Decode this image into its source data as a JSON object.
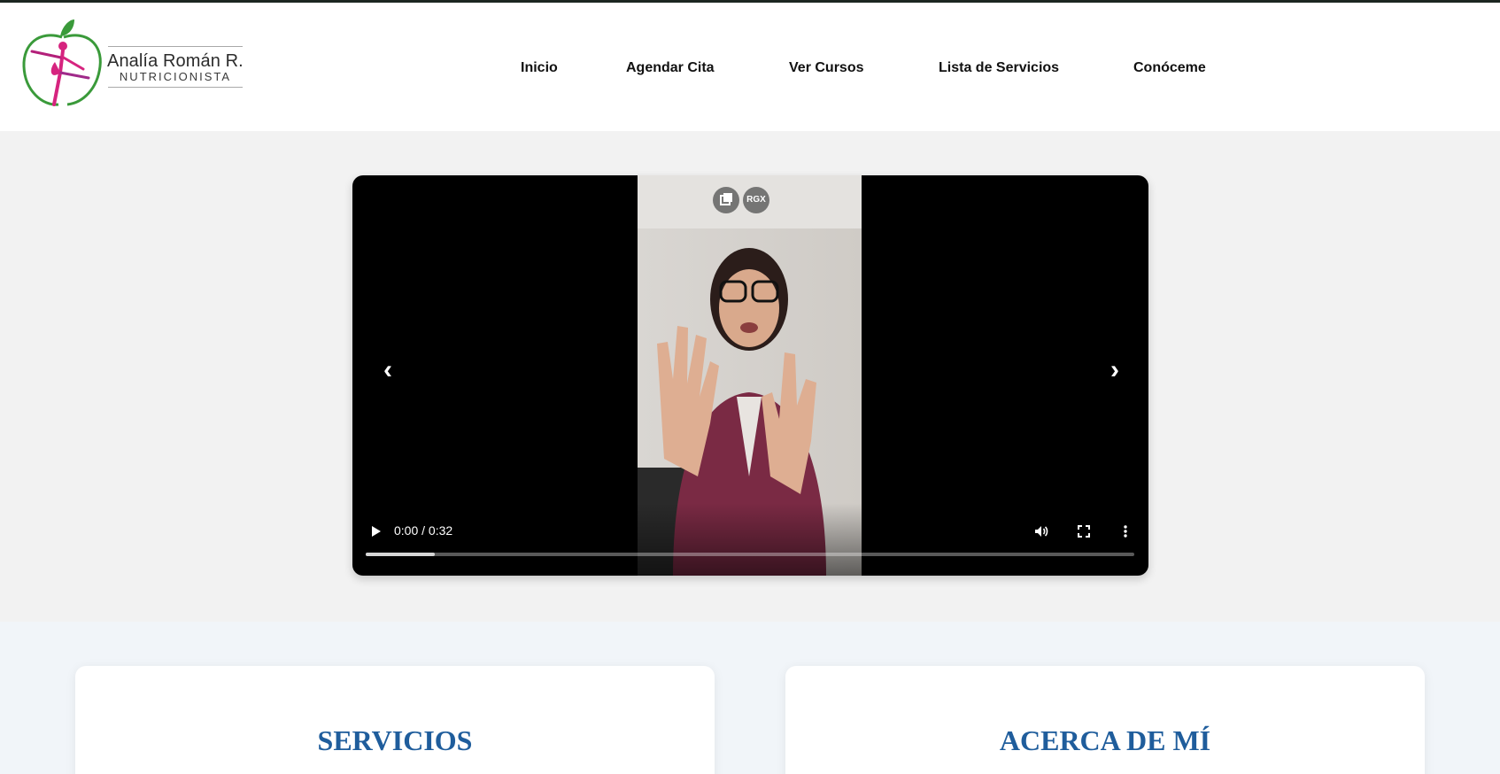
{
  "brand": {
    "name": "Analía Román R.",
    "subtitle": "NUTRICIONISTA"
  },
  "nav": {
    "items": [
      "Inicio",
      "Agendar Cita",
      "Ver Cursos",
      "Lista de Servicios",
      "Conóceme"
    ]
  },
  "video": {
    "time": "0:00 / 0:32",
    "progress": 0.09,
    "overlay_badge": "RGX",
    "prev_symbol": "‹",
    "next_symbol": "›"
  },
  "cards": {
    "services_title": "SERVICIOS",
    "about_title": "ACERCA DE MÍ"
  },
  "colors": {
    "accent_blue": "#1f5d9c",
    "logo_magenta": "#d6247f",
    "logo_green": "#3a9a3a",
    "shirt": "#7a2a44"
  },
  "icons": [
    "play-icon",
    "volume-icon",
    "fullscreen-icon",
    "more-options-icon",
    "picture-in-picture-icon"
  ]
}
